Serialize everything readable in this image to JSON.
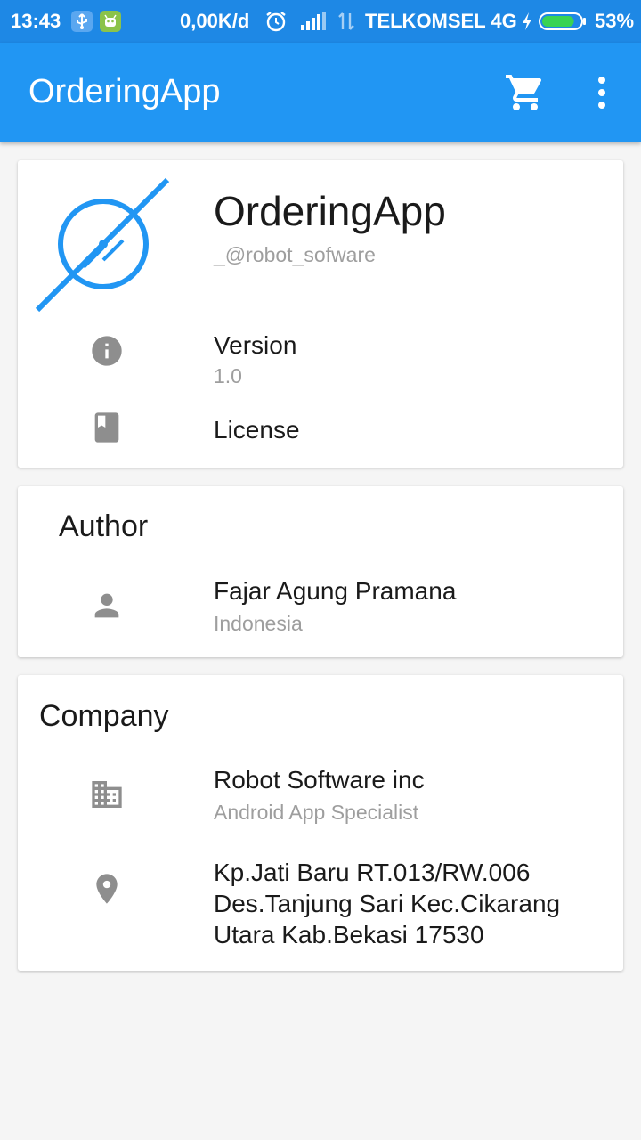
{
  "status_bar": {
    "time": "13:43",
    "net_speed": "0,00K/d",
    "carrier": "TELKOMSEL 4G",
    "battery_pct": "53%",
    "battery_level": 0.53,
    "icons": [
      "usb-icon",
      "android-debug-icon",
      "alarm-icon",
      "signal-icon",
      "data-transfer-icon",
      "charging-icon",
      "battery-icon"
    ]
  },
  "app_bar": {
    "title": "OrderingApp",
    "actions": [
      "cart-icon",
      "more-vert-icon"
    ]
  },
  "about": {
    "app_name": "OrderingApp",
    "handle": "_@robot_sofware",
    "version_label": "Version",
    "version_value": "1.0",
    "license_label": "License"
  },
  "author": {
    "heading": "Author",
    "name": "Fajar Agung Pramana",
    "country": "Indonesia"
  },
  "company": {
    "heading": "Company",
    "name": "Robot Software inc",
    "tagline": "Android App Specialist",
    "address_line1": "Kp.Jati Baru RT.013/RW.006",
    "address_line2": "Des.Tanjung Sari Kec.Cikarang",
    "address_line3": "Utara Kab.Bekasi 17530"
  },
  "colors": {
    "status_bar": "#1e88e5",
    "app_bar": "#2196f3",
    "logo": "#2196f3",
    "icon_grey": "#8e8e8e",
    "battery_fill": "#39d353"
  }
}
